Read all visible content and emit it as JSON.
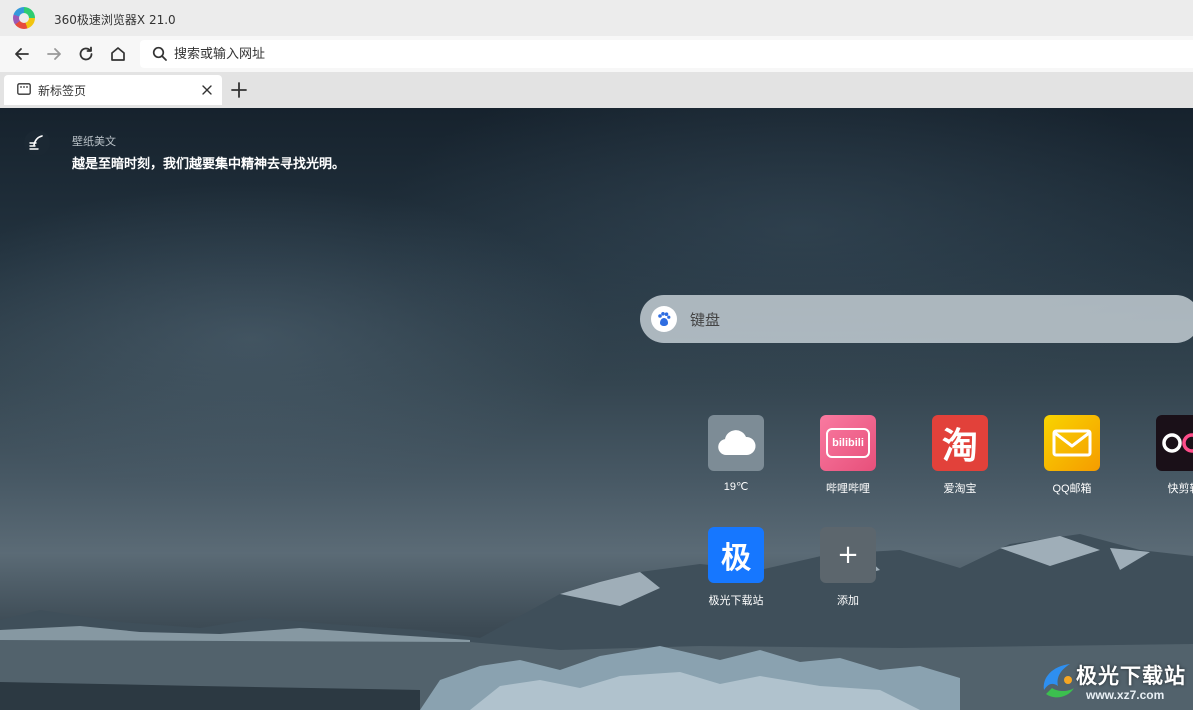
{
  "window": {
    "title": "360极速浏览器X 21.0"
  },
  "navbar": {
    "address_placeholder": "搜索或输入网址"
  },
  "tabs": [
    {
      "label": "新标签页"
    }
  ],
  "wallpaper": {
    "source": "壁纸美文",
    "quote": "越是至暗时刻，我们越要集中精神去寻找光明。"
  },
  "search": {
    "placeholder": "键盘",
    "engine_icon": "baidu-paw-icon"
  },
  "tiles": [
    {
      "label": "19℃",
      "icon": "cloud-icon",
      "color": "#7d8c96"
    },
    {
      "label": "哔哩哔哩",
      "icon": "bilibili-icon",
      "color": "#f0648c",
      "glyph": "bilibili"
    },
    {
      "label": "爱淘宝",
      "icon": "taobao-icon",
      "color": "#e2413a",
      "glyph": "淘"
    },
    {
      "label": "QQ邮箱",
      "icon": "mail-icon",
      "color": "#f8b400"
    },
    {
      "label": "快剪辑",
      "icon": "kuaijianji-icon",
      "color": "#1a1018"
    },
    {
      "label": "极光下载站",
      "icon": "jiguang-icon",
      "color": "#1677ff",
      "glyph": "极"
    },
    {
      "label": "添加",
      "icon": "add-icon",
      "color": "#5c666d",
      "glyph": "+"
    }
  ],
  "watermark": {
    "text": "极光下载站",
    "url": "www.xz7.com"
  }
}
